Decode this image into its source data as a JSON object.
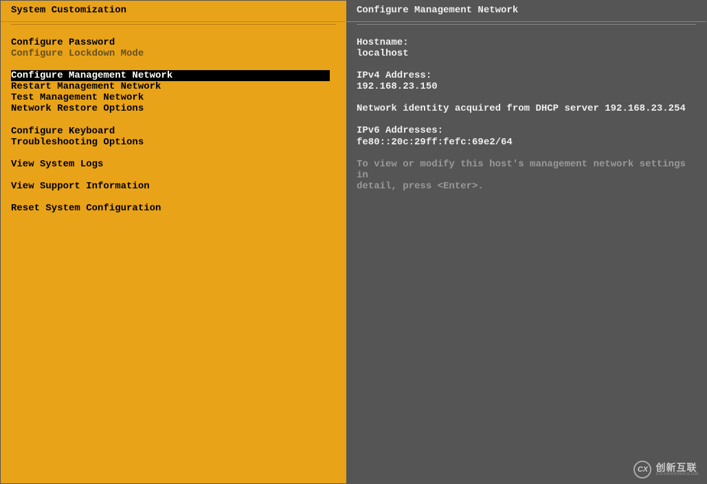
{
  "left": {
    "title": "System Customization",
    "groups": [
      {
        "items": [
          {
            "label": "Configure Password",
            "disabled": false,
            "selected": false
          },
          {
            "label": "Configure Lockdown Mode",
            "disabled": true,
            "selected": false
          }
        ]
      },
      {
        "items": [
          {
            "label": "Configure Management Network",
            "disabled": false,
            "selected": true
          },
          {
            "label": "Restart Management Network",
            "disabled": false,
            "selected": false
          },
          {
            "label": "Test Management Network",
            "disabled": false,
            "selected": false
          },
          {
            "label": "Network Restore Options",
            "disabled": false,
            "selected": false
          }
        ]
      },
      {
        "items": [
          {
            "label": "Configure Keyboard",
            "disabled": false,
            "selected": false
          },
          {
            "label": "Troubleshooting Options",
            "disabled": false,
            "selected": false
          }
        ]
      },
      {
        "items": [
          {
            "label": "View System Logs",
            "disabled": false,
            "selected": false
          }
        ]
      },
      {
        "items": [
          {
            "label": "View Support Information",
            "disabled": false,
            "selected": false
          }
        ]
      },
      {
        "items": [
          {
            "label": "Reset System Configuration",
            "disabled": false,
            "selected": false
          }
        ]
      }
    ]
  },
  "right": {
    "title": "Configure Management Network",
    "hostname_label": "Hostname:",
    "hostname_value": "localhost",
    "ipv4_label": "IPv4 Address:",
    "ipv4_value": "192.168.23.150",
    "dhcp_text": "Network identity acquired from DHCP server 192.168.23.254",
    "ipv6_label": "IPv6 Addresses:",
    "ipv6_value": "fe80::20c:29ff:fefc:69e2/64",
    "help_line1": "To view or modify this host's management network settings in",
    "help_line2": "detail, press <Enter>."
  },
  "watermark": {
    "icon_text": "CX",
    "main": "创新互联",
    "sub": "CXIANGXINHULIAN"
  }
}
